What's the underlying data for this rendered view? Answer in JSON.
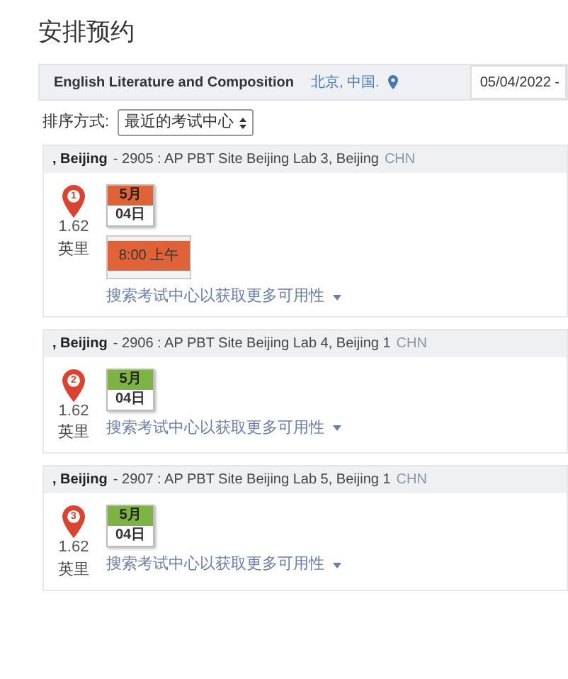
{
  "title": "安排预约",
  "filter_bar": {
    "exam": "English Literature and Composition",
    "location": "北京, 中国.",
    "date": "05/04/2022 -"
  },
  "sort": {
    "label": "排序方式:",
    "value": "最近的考试中心"
  },
  "centers": [
    {
      "city": ", Beijing",
      "detail": "- 2905 : AP PBT Site Beijing Lab 3, Beijing",
      "country": "CHN",
      "pin_number": "1",
      "distance": "1.62",
      "unit": "英里",
      "month": "5月",
      "day": "04日",
      "color": "#e06238",
      "times": [
        "8:00 上午"
      ],
      "link": "搜索考试中心以获取更多可用性"
    },
    {
      "city": ", Beijing",
      "detail": "- 2906 : AP PBT Site Beijing Lab 4, Beijing 1",
      "country": "CHN",
      "pin_number": "2",
      "distance": "1.62",
      "unit": "英里",
      "month": "5月",
      "day": "04日",
      "color": "#7cb342",
      "link": "搜索考试中心以获取更多可用性"
    },
    {
      "city": ", Beijing",
      "detail": "- 2907 : AP PBT Site Beijing Lab 5, Beijing 1",
      "country": "CHN",
      "pin_number": "3",
      "distance": "1.62",
      "unit": "英里",
      "month": "5月",
      "day": "04日",
      "color": "#7cb342",
      "link": "搜索考试中心以获取更多可用性"
    }
  ]
}
